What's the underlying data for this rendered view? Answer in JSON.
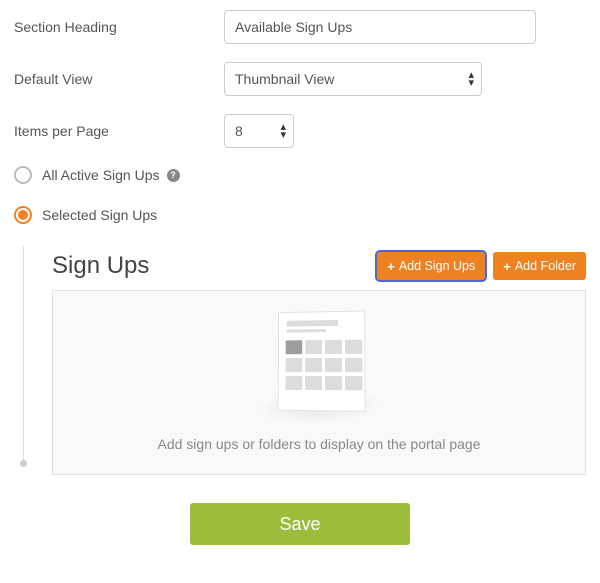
{
  "form": {
    "section_heading_label": "Section Heading",
    "section_heading_value": "Available Sign Ups",
    "default_view_label": "Default View",
    "default_view_value": "Thumbnail View",
    "items_per_page_label": "Items per Page",
    "items_per_page_value": "8"
  },
  "radios": {
    "all_active_label": "All Active Sign Ups",
    "selected_label": "Selected Sign Ups"
  },
  "panel": {
    "title": "Sign Ups",
    "add_signups_label": "Add Sign Ups",
    "add_folder_label": "Add Folder",
    "empty_message": "Add sign ups or folders to display on the portal page"
  },
  "actions": {
    "save_label": "Save"
  },
  "colors": {
    "accent_orange": "#ee8122",
    "accent_green": "#9cbd3b"
  }
}
